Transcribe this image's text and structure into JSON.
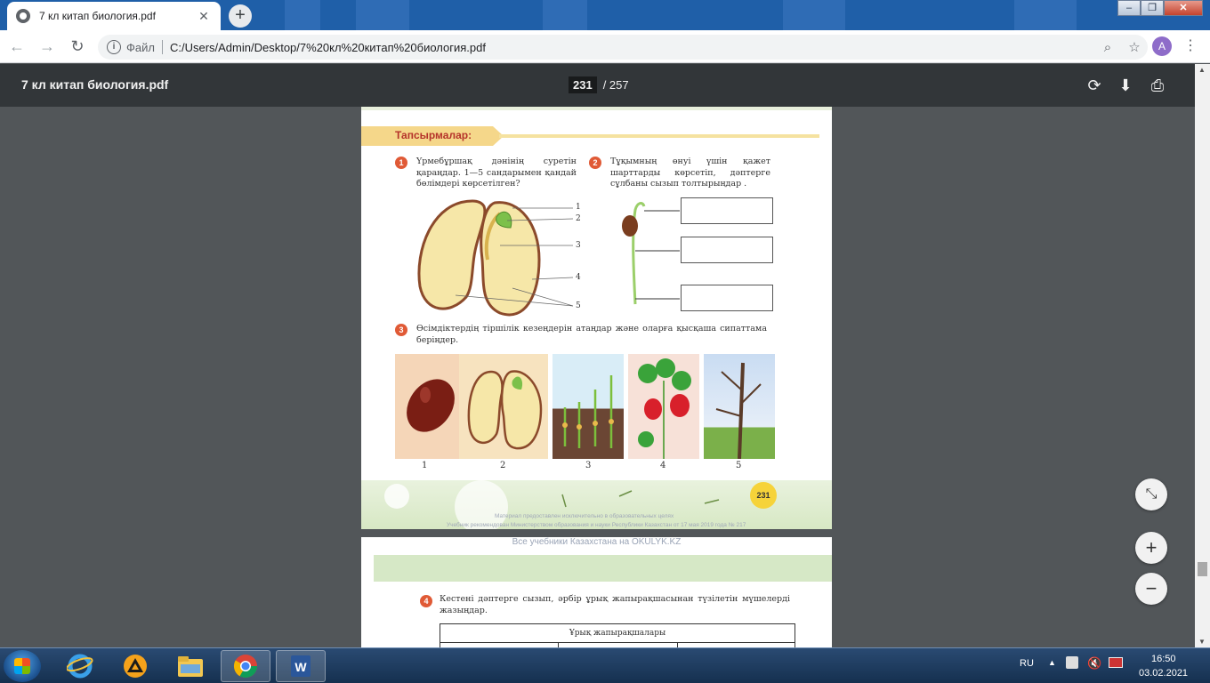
{
  "browser": {
    "tab_title": "7 кл китап биология.pdf",
    "tab_close": "✕",
    "new_tab": "+",
    "window_controls": {
      "minimize": "–",
      "restore": "❐",
      "close": "✕"
    },
    "scheme_label": "Файл",
    "url": "C:/Users/Admin/Desktop/7%20кл%20китап%20биология.pdf",
    "avatar_letter": "A"
  },
  "pdf_toolbar": {
    "file_name": "7 кл китап биология.pdf",
    "current_page": "231",
    "total_pages": "/ 257"
  },
  "page231": {
    "section_title": "Тапсырмалар:",
    "q1_number": "1",
    "q1_text": "Үрмебұршақ дәнінің суретін қараңдар. 1—5 сандарымен қандай бөлімдері көрсетілген?",
    "q2_number": "2",
    "q2_text": "Тұқымның өнуі үшін қажет шарттарды көрсетіп, дәптерге сұлбаны сызып толтырыңдар .",
    "q3_number": "3",
    "q3_text": "Өсімдіктердің тіршілік кезеңдерін атаңдар және оларға қысқаша сипаттама беріңдер.",
    "diagram_labels": [
      "1",
      "2",
      "3",
      "4",
      "5"
    ],
    "photo_labels": [
      "1",
      "2",
      "3",
      "4",
      "5"
    ],
    "page_badge": "231",
    "watermark_line1": "Материал предоставлен исключительно в образовательных целях",
    "watermark_line2": "Учебник рекомендован Министерством образования и науки Республики Казахстан от 17 мая 2019 года № 217"
  },
  "page232": {
    "watermark": "Все учебники Казахстана на OKULYK.KZ",
    "q4_number": "4",
    "q4_text": "Кестені дәптерге сызып, әрбір ұрық жапырақшасынан түзілетін мүшелерді жазыңдар.",
    "table_header": "Ұрық жапырақшалары"
  },
  "taskbar": {
    "language": "RU",
    "time": "16:50",
    "date": "03.02.2021"
  }
}
